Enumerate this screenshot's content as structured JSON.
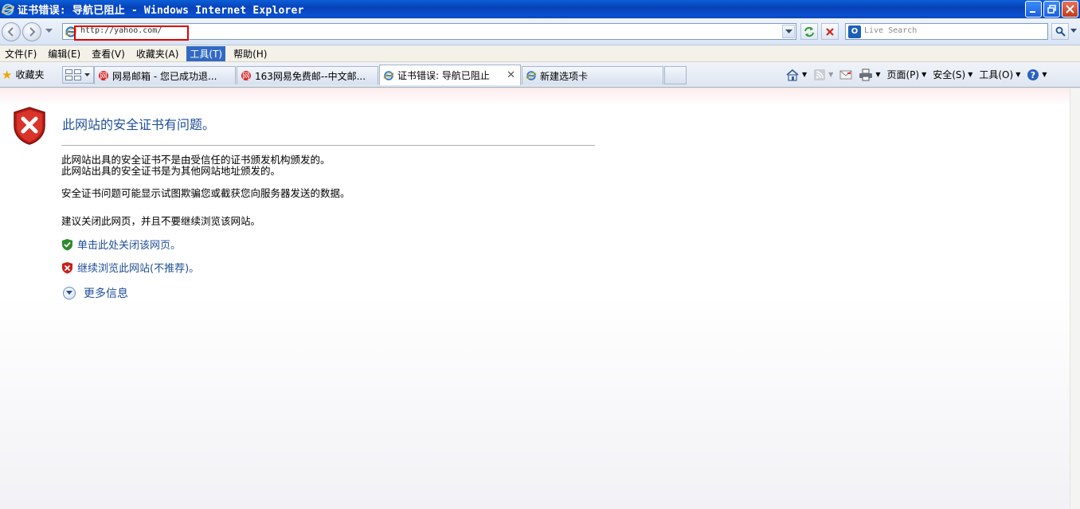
{
  "window": {
    "title": "证书错误: 导航已阻止 - Windows Internet Explorer"
  },
  "address_bar": {
    "url": "http://yahoo.com/"
  },
  "search": {
    "placeholder": "Live Search"
  },
  "menu": {
    "items": [
      "文件(F)",
      "编辑(E)",
      "查看(V)",
      "收藏夹(A)",
      "工具(T)",
      "帮助(H)"
    ],
    "active_index": 4
  },
  "favorites": {
    "label": "收藏夹"
  },
  "tabs": [
    {
      "label": "网易邮箱 - 您已成功退...",
      "icon": "netease-icon",
      "active": false
    },
    {
      "label": "163网易免费邮--中文邮...",
      "icon": "netease-icon",
      "active": false
    },
    {
      "label": "证书错误: 导航已阻止",
      "icon": "ie-icon",
      "active": true
    },
    {
      "label": "新建选项卡",
      "icon": "ie-icon",
      "active": false
    }
  ],
  "commands": {
    "page_label": "页面(P)",
    "safety_label": "安全(S)",
    "tools_label": "工具(O)"
  },
  "content": {
    "heading": "此网站的安全证书有问题。",
    "para1_line1": "此网站出具的安全证书不是由受信任的证书颁发机构颁发的。",
    "para1_line2": "此网站出具的安全证书是为其他网站地址颁发的。",
    "para2": "安全证书问题可能显示试图欺骗您或截获您向服务器发送的数据。",
    "para3": "建议关闭此网页，并且不要继续浏览该网站。",
    "link_close": "单击此处关闭该网页。",
    "link_continue": "继续浏览此网站(不推荐)。",
    "more_info": "更多信息"
  },
  "colors": {
    "link": "#1f4e9a",
    "titlebar": "#0a50d0",
    "menu_highlight": "#316ac5",
    "shield_red": "#c8201a",
    "highlight_box": "#e00000"
  }
}
